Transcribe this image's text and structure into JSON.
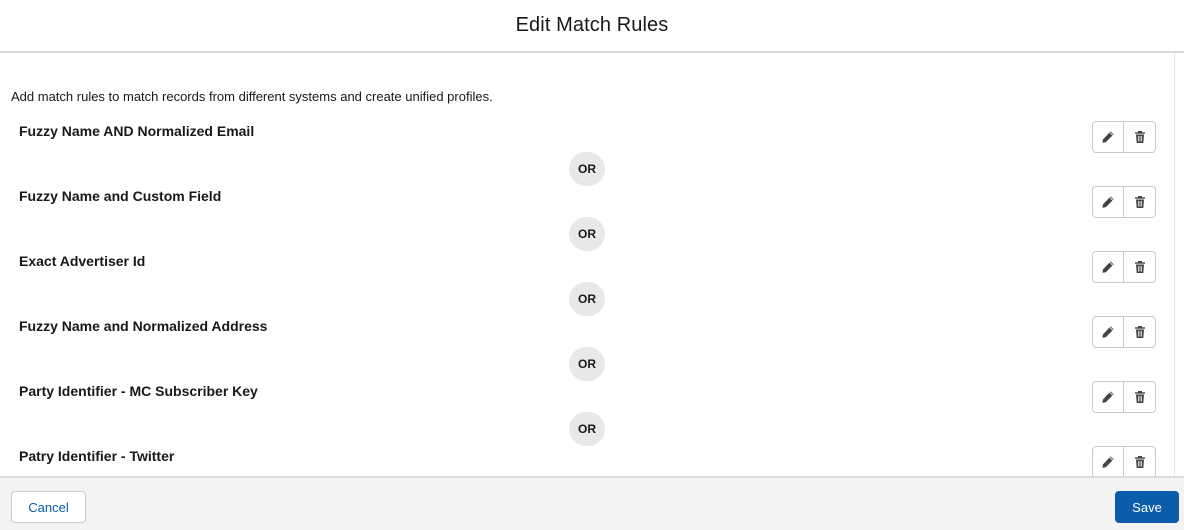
{
  "modal": {
    "title": "Edit Match Rules",
    "description": "Add match rules to match records from different systems and create unified profiles."
  },
  "rules": [
    {
      "name": "Fuzzy Name AND Normalized Email",
      "edit_icon": "pencil-icon",
      "delete_icon": "trash-icon"
    },
    {
      "name": "Fuzzy Name and Custom Field",
      "edit_icon": "pencil-icon",
      "delete_icon": "trash-icon"
    },
    {
      "name": "Exact Advertiser Id",
      "edit_icon": "pencil-icon",
      "delete_icon": "trash-icon"
    },
    {
      "name": "Fuzzy Name and Normalized Address",
      "edit_icon": "pencil-icon",
      "delete_icon": "trash-icon"
    },
    {
      "name": "Party Identifier - MC Subscriber Key",
      "edit_icon": "pencil-icon",
      "delete_icon": "trash-icon"
    },
    {
      "name": "Patry Identifier - Twitter",
      "edit_icon": "pencil-icon",
      "delete_icon": "trash-icon"
    }
  ],
  "connector_label": "OR",
  "footer": {
    "cancel_label": "Cancel",
    "save_label": "Save"
  },
  "colors": {
    "brand": "#0b5cab",
    "pill": "#e8e8e8",
    "footer_bg": "#f3f3f3"
  }
}
